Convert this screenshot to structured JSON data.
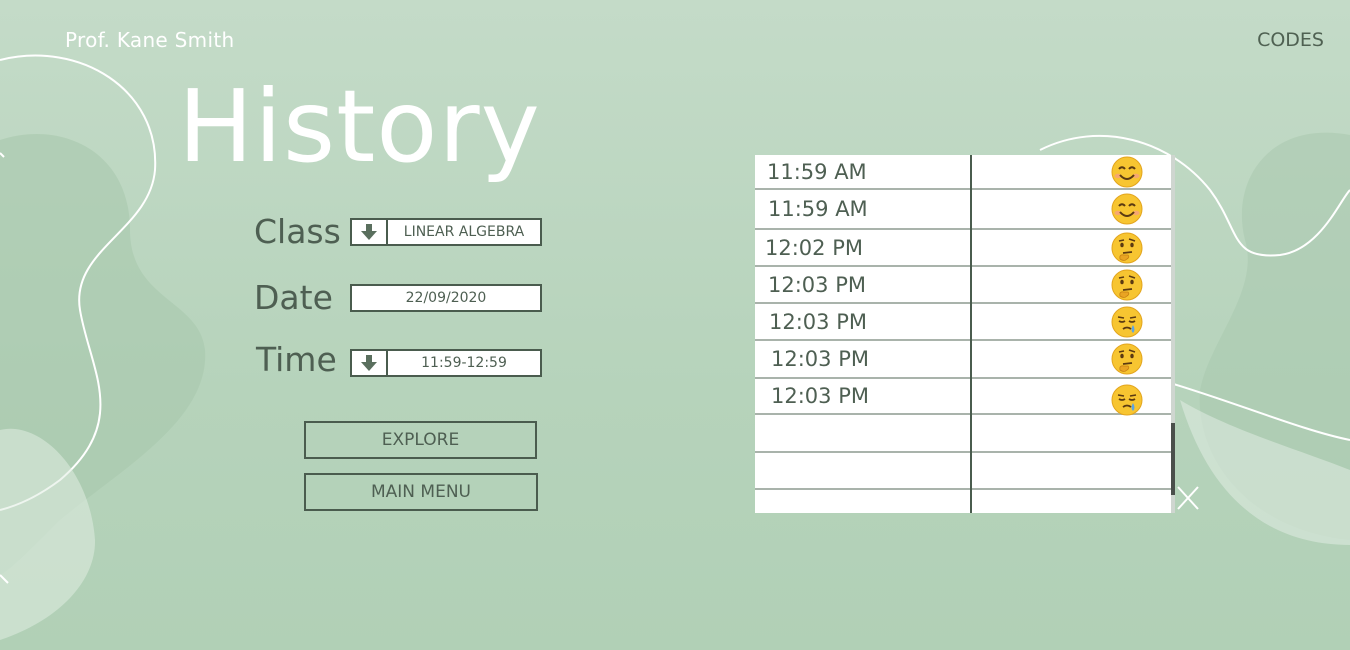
{
  "header": {
    "user_name": "Prof. Kane Smith",
    "codes_link": "CODES"
  },
  "page_title": "History",
  "form": {
    "class": {
      "label": "Class",
      "value": "LINEAR ALGEBRA",
      "icon": "arrow-down-icon"
    },
    "date": {
      "label": "Date",
      "value": "22/09/2020"
    },
    "time": {
      "label": "Time",
      "value": "11:59-12:59",
      "icon": "arrow-down-icon"
    }
  },
  "buttons": {
    "explore": "EXPLORE",
    "main_menu": "MAIN MENU"
  },
  "table": {
    "rows": [
      {
        "time": "11:59 AM",
        "mood": "smiling-face-icon"
      },
      {
        "time": "11:59 AM",
        "mood": "smiling-face-icon"
      },
      {
        "time": "12:02 PM",
        "mood": "thinking-face-icon"
      },
      {
        "time": "12:03 PM",
        "mood": "thinking-face-icon"
      },
      {
        "time": "12:03 PM",
        "mood": "sleepy-face-icon"
      },
      {
        "time": "12:03 PM",
        "mood": "thinking-face-icon"
      },
      {
        "time": "12:03 PM",
        "mood": "sleepy-face-icon"
      },
      {
        "time": "",
        "mood": ""
      },
      {
        "time": "",
        "mood": ""
      },
      {
        "time": "",
        "mood": ""
      }
    ]
  },
  "colors": {
    "background": "#bcd7c1",
    "text_dark": "#4e5f52",
    "text_light": "#ffffff",
    "border": "#4a5c4e"
  }
}
